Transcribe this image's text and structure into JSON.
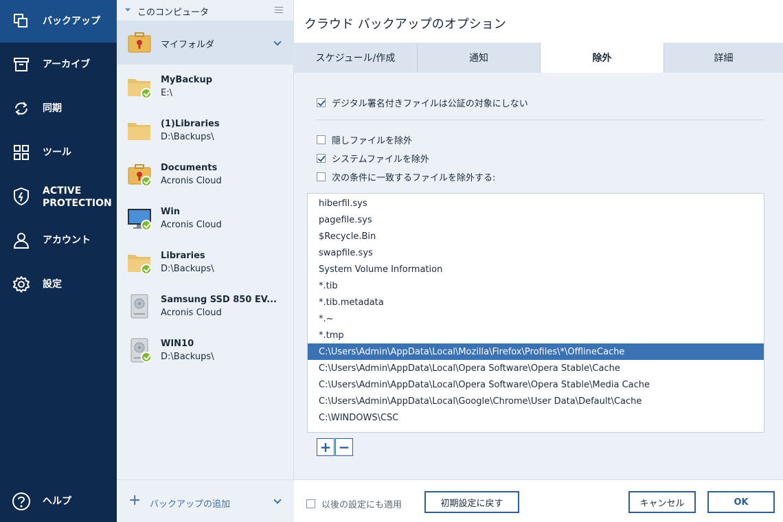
{
  "nav": {
    "items": [
      {
        "label": "バックアップ",
        "icon": "backup-icon"
      },
      {
        "label": "アーカイブ",
        "icon": "archive-icon"
      },
      {
        "label": "同期",
        "icon": "sync-icon"
      },
      {
        "label": "ツール",
        "icon": "tools-icon"
      },
      {
        "label_line1": "ACTIVE",
        "label_line2": "PROTECTION",
        "icon": "shield-icon"
      },
      {
        "label": "アカウント",
        "icon": "account-icon"
      },
      {
        "label": "設定",
        "icon": "gear-icon"
      }
    ],
    "help": {
      "label": "ヘルプ",
      "icon": "help-icon"
    }
  },
  "backups": {
    "header": "このコンピュータ",
    "items": [
      {
        "name": "マイフォルダ",
        "sub": "",
        "icon": "briefcase-icon"
      },
      {
        "name": "MyBackup",
        "sub": "E:\\",
        "icon": "folder-icon"
      },
      {
        "name": "(1)Libraries",
        "sub": "D:\\Backups\\",
        "icon": "folder-icon"
      },
      {
        "name": "Documents",
        "sub": "Acronis Cloud",
        "icon": "briefcase-icon"
      },
      {
        "name": "Win",
        "sub": "Acronis Cloud",
        "icon": "monitor-icon"
      },
      {
        "name": "Libraries",
        "sub": "D:\\Backups\\",
        "icon": "folder-icon"
      },
      {
        "name": "Samsung SSD 850 EV...",
        "sub": "Acronis Cloud",
        "icon": "disk-icon"
      },
      {
        "name": "WIN10",
        "sub": "D:\\Backups\\",
        "icon": "disk-icon"
      }
    ],
    "add_label": "バックアップの追加"
  },
  "main": {
    "title": "クラウド バックアップのオプション",
    "tabs": [
      "スケジュール/作成",
      "通知",
      "除外",
      "詳細"
    ],
    "options": {
      "digital_signed": "デジタル署名付きファイルは公証の対象にしない",
      "hidden": "隠しファイルを除外",
      "system": "システムファイルを除外",
      "criteria": "次の条件に一致するファイルを除外する:"
    },
    "exclusions": [
      "hiberfil.sys",
      "pagefile.sys",
      "$Recycle.Bin",
      "swapfile.sys",
      "System Volume Information",
      "*.tib",
      "*.tib.metadata",
      "*.~",
      "*.tmp",
      "C:\\Users\\Admin\\AppData\\Local\\Mozilla\\Firefox\\Profiles\\*\\OfflineCache",
      "C:\\Users\\Admin\\AppData\\Local\\Opera Software\\Opera Stable\\Cache",
      "C:\\Users\\Admin\\AppData\\Local\\Opera Software\\Opera Stable\\Media Cache",
      "C:\\Users\\Admin\\AppData\\Local\\Google\\Chrome\\User Data\\Default\\Cache",
      "C:\\WINDOWS\\CSC"
    ],
    "add_symbol": "+",
    "remove_symbol": "−"
  },
  "footer": {
    "apply_future": "以後の設定にも適用",
    "reset": "初期設定に戻す",
    "cancel": "キャンセル",
    "ok": "OK"
  },
  "colors": {
    "nav_bg": "#0f2a4f",
    "nav_active": "#1a4f8b",
    "accent": "#2c5f99",
    "selected_row": "#3a72b4",
    "check_green": "#7cba2f"
  }
}
